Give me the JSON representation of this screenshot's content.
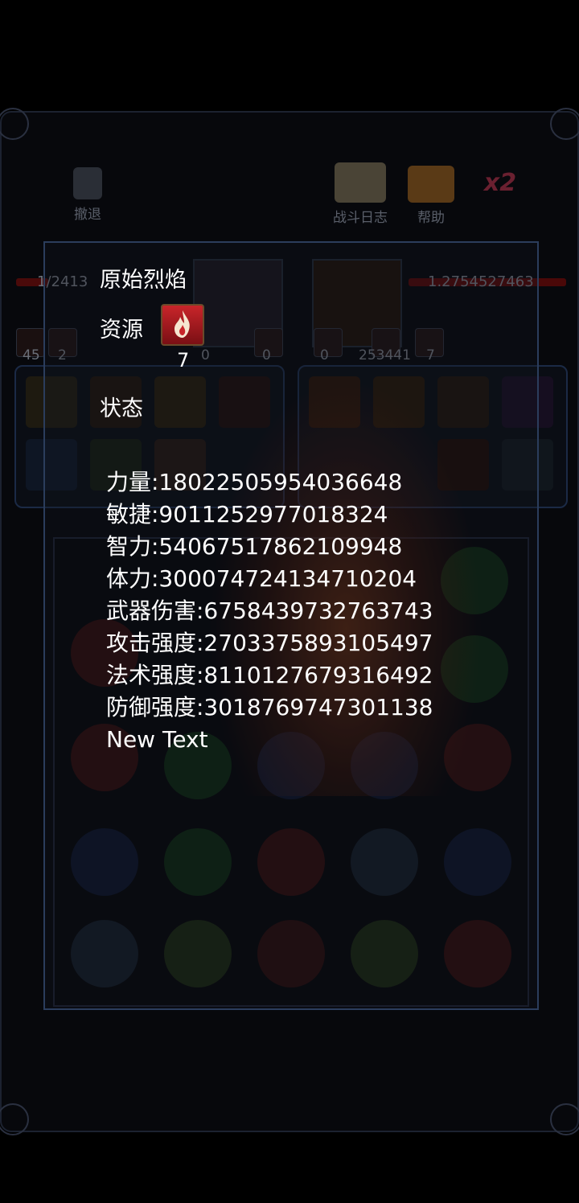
{
  "toolbar": {
    "retreat_label": "撤退",
    "battle_log_label": "战斗日志",
    "help_label": "帮助",
    "speed_label": "x2"
  },
  "left_unit": {
    "hp_text": "1/2413",
    "counter_a": "45",
    "counter_b": "2",
    "counter_c": "0",
    "counter_d": "0"
  },
  "right_unit": {
    "hp_text": "1.2754527463",
    "counter_a": "0",
    "counter_b": "253441",
    "counter_c": "7"
  },
  "dialog": {
    "title": "原始烈焰",
    "resource_label": "资源",
    "resource_icon": "flame-icon",
    "resource_count": "7",
    "status_label": "状态",
    "stats": [
      "力量:18022505954036648",
      "敏捷:9011252977018324",
      "智力:54067517862109948",
      "体力:300074724134710204",
      "武器伤害:6758439732763743",
      "攻击强度:2703375893105497",
      "法术强度:8110127679316492",
      "防御强度:3018769747301138",
      "New Text"
    ]
  },
  "colors": {
    "dialog_border": "#2b3d5c",
    "resource_icon": "#c8252a",
    "hp_bar": "#b01515"
  }
}
